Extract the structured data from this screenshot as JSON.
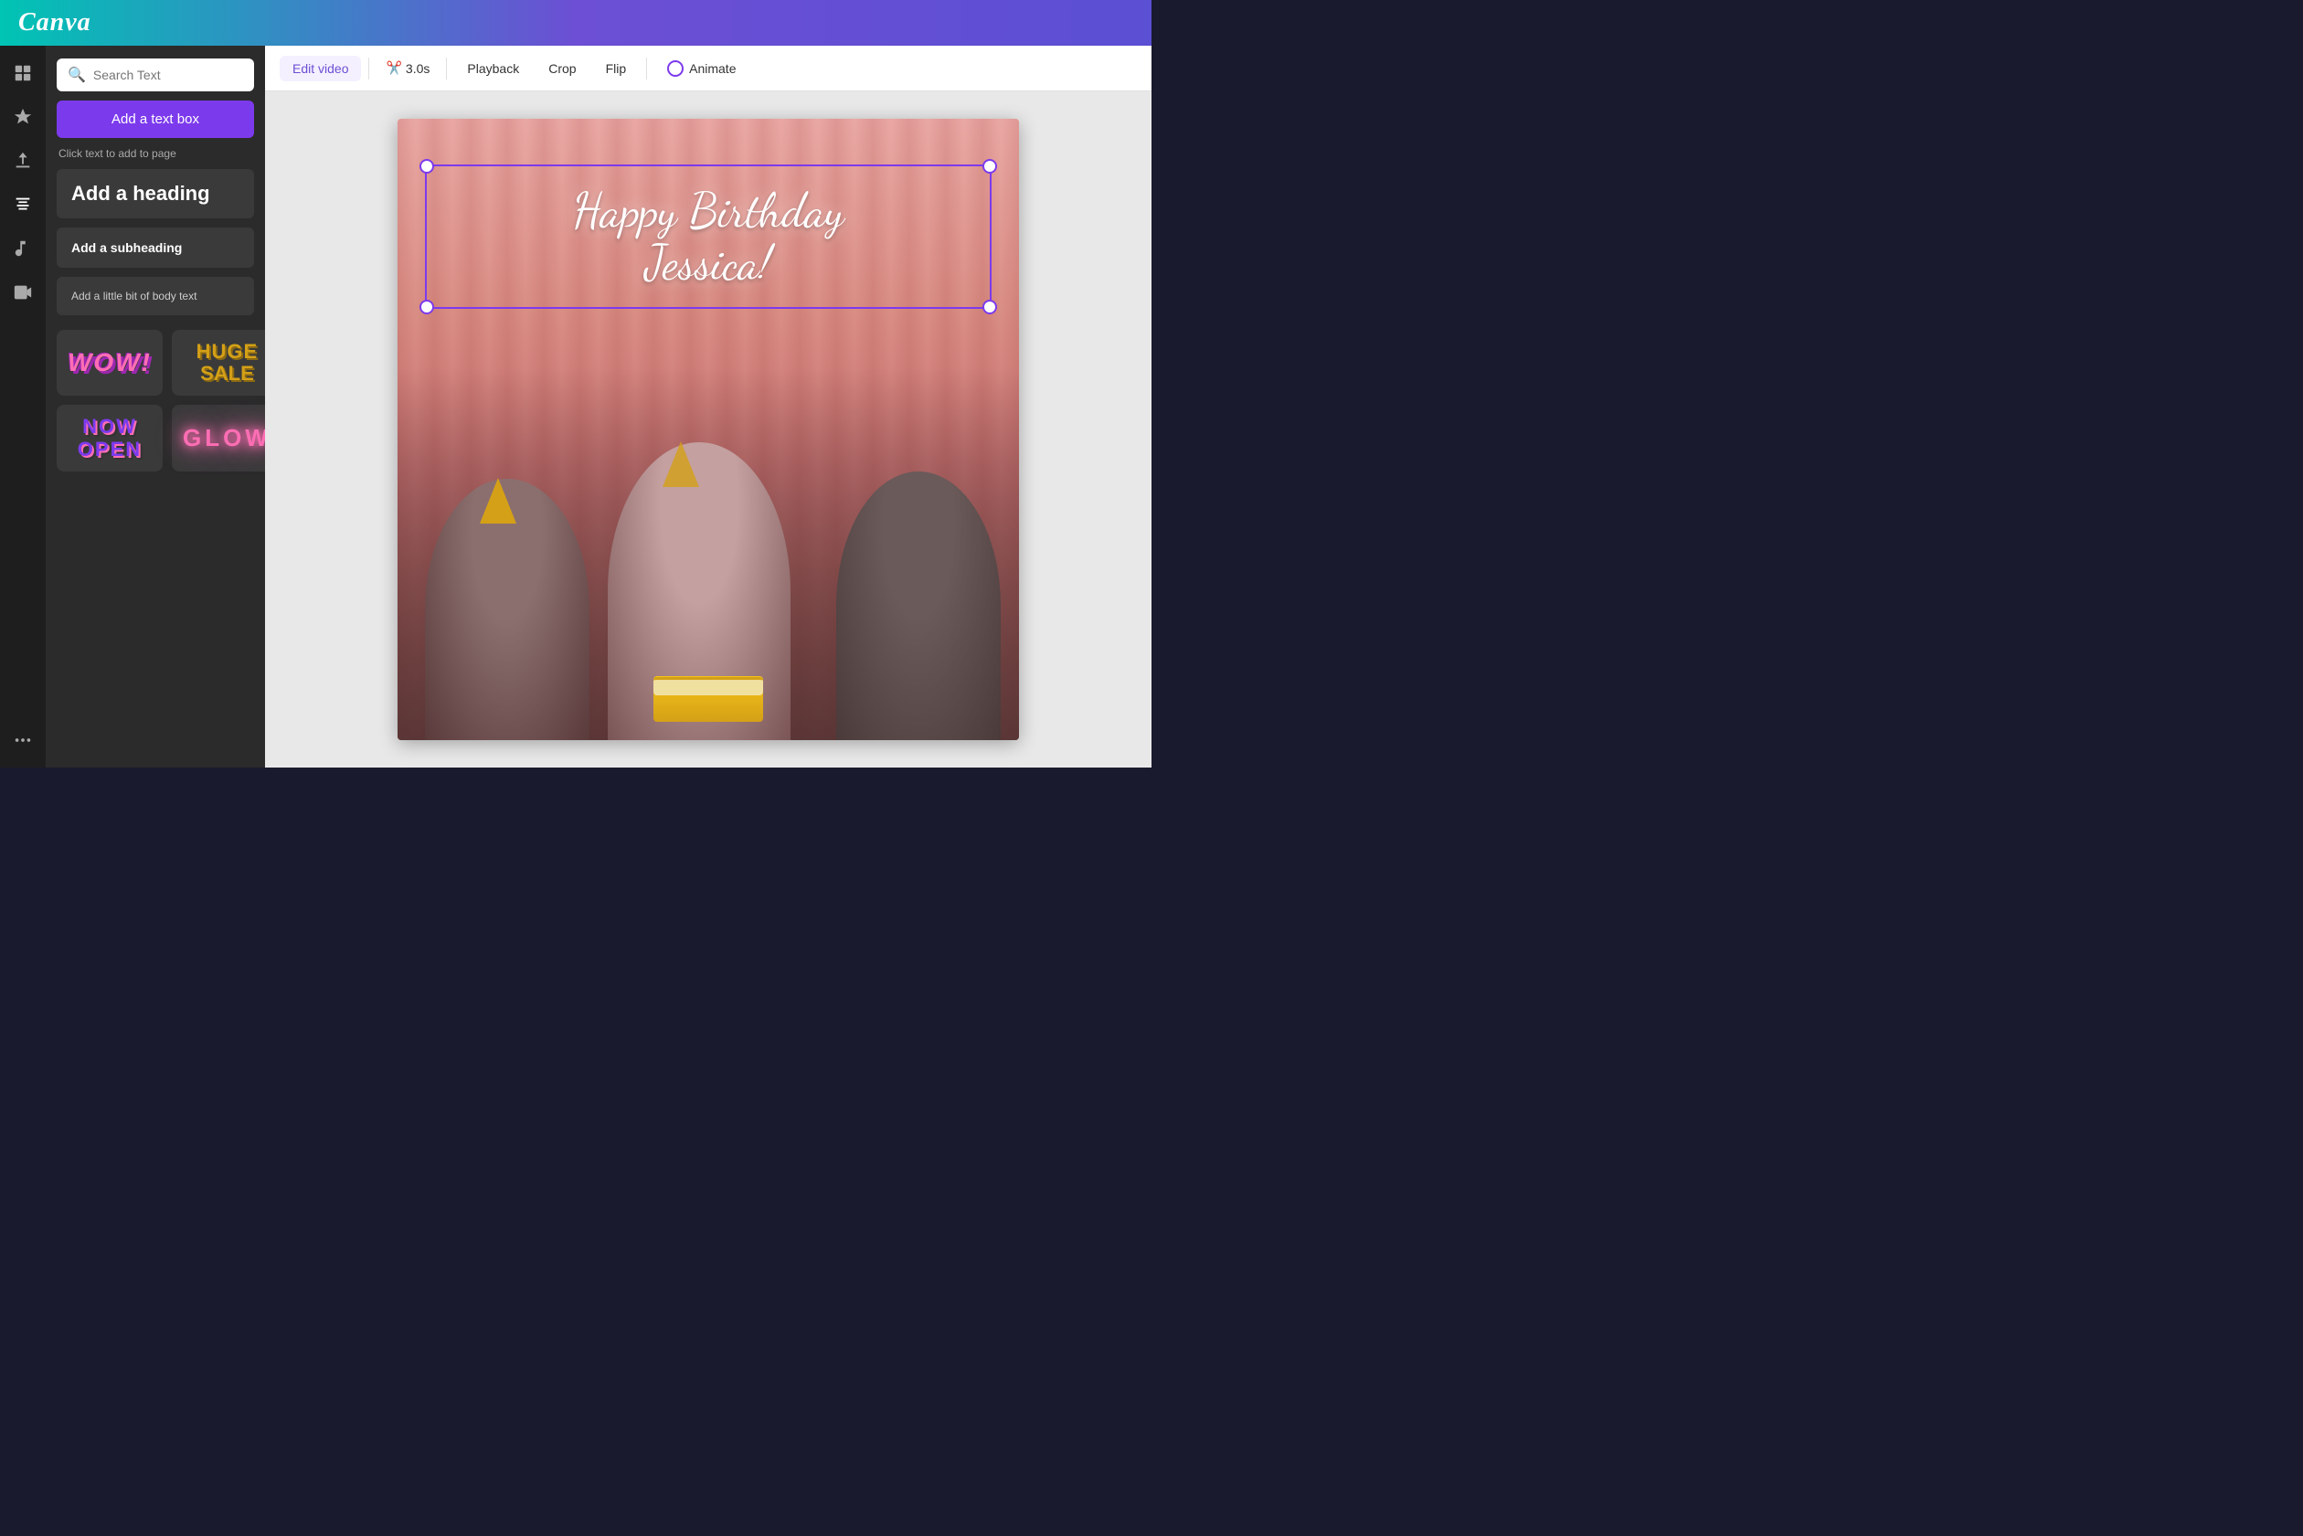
{
  "header": {
    "logo": "Canva"
  },
  "sidebar": {
    "icons": [
      {
        "name": "layout-icon",
        "symbol": "⊞",
        "label": "Layout"
      },
      {
        "name": "elements-icon",
        "symbol": "✦",
        "label": "Elements"
      },
      {
        "name": "uploads-icon",
        "symbol": "↑",
        "label": "Uploads"
      },
      {
        "name": "text-icon",
        "symbol": "T",
        "label": "Text",
        "active": true
      },
      {
        "name": "audio-icon",
        "symbol": "♪",
        "label": "Audio"
      },
      {
        "name": "video-icon",
        "symbol": "▶",
        "label": "Video"
      },
      {
        "name": "more-icon",
        "symbol": "•••",
        "label": "More"
      }
    ]
  },
  "text_panel": {
    "search": {
      "placeholder": "Search Text"
    },
    "add_textbox_button": "Add a text box",
    "click_hint": "Click text to add to page",
    "text_styles": [
      {
        "label": "Add a heading",
        "size": "heading"
      },
      {
        "label": "Add a subheading",
        "size": "subheading"
      },
      {
        "label": "Add a little bit of body text",
        "size": "body"
      }
    ],
    "style_samples": [
      {
        "name": "wow",
        "display": "WOW!"
      },
      {
        "name": "huge-sale",
        "display": "HUGE SALE"
      },
      {
        "name": "now-open",
        "display": "NOW OPEN"
      },
      {
        "name": "glow",
        "display": "GLOW"
      }
    ]
  },
  "toolbar": {
    "buttons": [
      {
        "label": "Edit video",
        "active": true
      },
      {
        "label": "3.0s",
        "scissors": true
      },
      {
        "label": "Playback"
      },
      {
        "label": "Crop"
      },
      {
        "label": "Flip"
      },
      {
        "label": "Animate",
        "has_icon": true
      }
    ]
  },
  "canvas": {
    "birthday_text_line1": "Happy Birthday",
    "birthday_text_line2": "Jessica!"
  }
}
